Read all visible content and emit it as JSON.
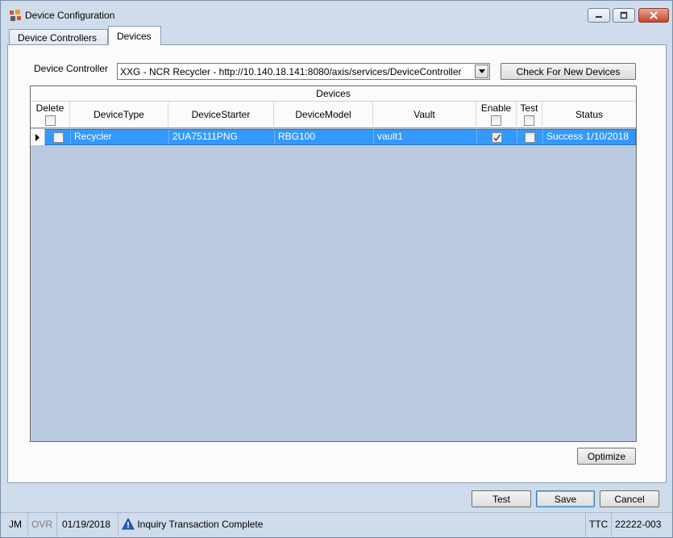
{
  "window": {
    "title": "Device Configuration",
    "icons": [
      "app-logo-icon",
      "minimize-icon",
      "maximize-icon",
      "close-icon"
    ]
  },
  "tabs": [
    {
      "label": "Device Controllers",
      "selected": false
    },
    {
      "label": "Devices",
      "selected": true
    }
  ],
  "device_controller": {
    "label": "Device Controller",
    "selected_value": "XXG - NCR Recycler - http://10.140.18.141:8080/axis/services/DeviceController"
  },
  "buttons": {
    "check_new_devices": "Check For New Devices",
    "optimize": "Optimize",
    "test": "Test",
    "save": "Save",
    "cancel": "Cancel"
  },
  "grid": {
    "caption": "Devices",
    "columns": {
      "delete": "Delete",
      "device_type": "DeviceType",
      "device_starter": "DeviceStarter",
      "device_model": "DeviceModel",
      "vault": "Vault",
      "enable": "Enable",
      "test": "Test",
      "status": "Status"
    },
    "rows": [
      {
        "delete": false,
        "device_type": "Recycler",
        "device_starter": "2UA75111PNG",
        "device_model": "RBG100",
        "vault": "vault1",
        "enable": true,
        "test": false,
        "status": "Success 1/10/2018",
        "selected": true
      }
    ]
  },
  "status_bar": {
    "user": "JM",
    "mode": "OVR",
    "date": "01/19/2018",
    "message": "Inquiry Transaction Complete",
    "code": "TTC",
    "terminal": "22222-003"
  },
  "colors": {
    "selection": "#3399ff",
    "grid_background": "#b9c9e0",
    "window_background": "#cfdcec"
  }
}
